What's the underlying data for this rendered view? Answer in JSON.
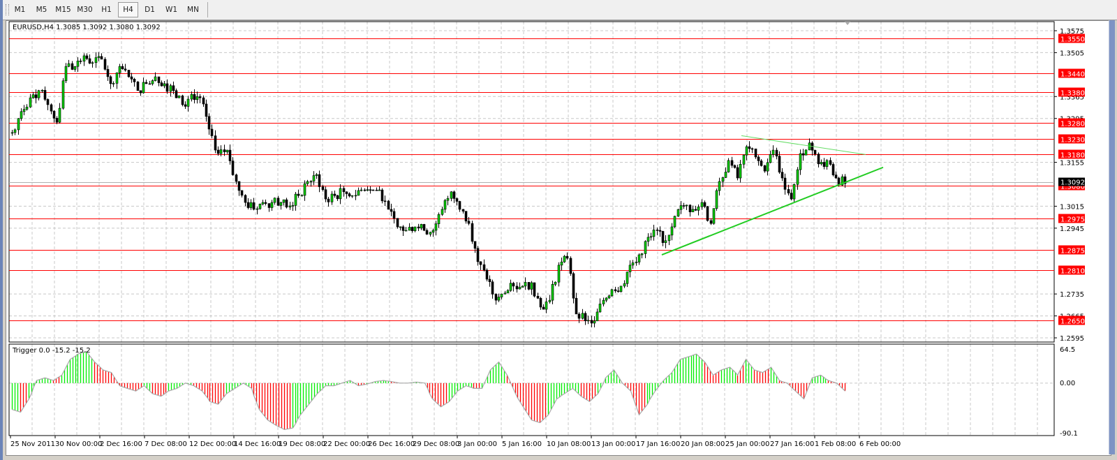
{
  "toolbar": {
    "timeframes": [
      "M1",
      "M5",
      "M15",
      "M30",
      "H1",
      "H4",
      "D1",
      "W1",
      "MN"
    ],
    "active": "H4"
  },
  "chart": {
    "header": "EURUSD,H4  1.3085 1.3092 1.3080 1.3092",
    "current_price": 1.3092,
    "current_price_label": "1.3092"
  },
  "chart_data": {
    "type": "candlestick",
    "symbol": "EURUSD",
    "timeframe": "H4",
    "ylim": [
      1.2595,
      1.3575
    ],
    "price_ticks": [
      "1.3575",
      "1.3505",
      "1.3365",
      "1.3295",
      "1.3155",
      "1.3015",
      "1.2945",
      "1.2735",
      "1.2665",
      "1.2595"
    ],
    "horizontal_levels": [
      "1.3550",
      "1.3440",
      "1.3380",
      "1.3280",
      "1.3230",
      "1.3180",
      "1.3080",
      "1.2975",
      "1.2875",
      "1.2810",
      "1.2650"
    ],
    "level_color": "#ff0000",
    "closes": [
      1.325,
      1.3317,
      1.3361,
      1.3384,
      1.3339,
      1.3283,
      1.3461,
      1.3461,
      1.3495,
      1.3473,
      1.3484,
      1.3406,
      1.3461,
      1.3428,
      1.3384,
      1.3406,
      1.3428,
      1.3406,
      1.3384,
      1.3339,
      1.3372,
      1.3361,
      1.3261,
      1.3183,
      1.3194,
      1.3094,
      1.3027,
      1.3005,
      1.3027,
      1.3027,
      1.3027,
      1.3016,
      1.3049,
      1.3094,
      1.3116,
      1.3038,
      1.3049,
      1.3061,
      1.3049,
      1.3067,
      1.3067,
      1.3067,
      1.3005,
      1.2949,
      1.2938,
      1.2949,
      1.2938,
      1.2938,
      1.3005,
      1.3061,
      1.3005,
      1.296,
      1.2838,
      1.2782,
      1.2715,
      1.2738,
      1.276,
      1.276,
      1.2771,
      1.2693,
      1.2715,
      1.2827,
      1.2849,
      1.2671,
      1.2649,
      1.2649,
      1.2715,
      1.2749,
      1.276,
      1.2827,
      1.286,
      1.2916,
      1.2938,
      1.2905,
      1.2983,
      1.3016,
      1.3005,
      1.3027,
      1.296,
      1.3094,
      1.3161,
      1.3105,
      1.3205,
      1.3172,
      1.3127,
      1.3194,
      1.3105,
      1.3038,
      1.3183,
      1.3217,
      1.315,
      1.3161,
      1.3105,
      1.3087
    ],
    "time_labels": [
      "25 Nov 2011",
      "30 Nov 00:00",
      "2 Dec 16:00",
      "7 Dec 08:00",
      "12 Dec 00:00",
      "14 Dec 16:00",
      "19 Dec 08:00",
      "22 Dec 00:00",
      "26 Dec 16:00",
      "29 Dec 08:00",
      "3 Jan 00:00",
      "5 Jan 16:00",
      "10 Jan 08:00",
      "13 Jan 00:00",
      "17 Jan 16:00",
      "20 Jan 08:00",
      "25 Jan 00:00",
      "27 Jan 16:00",
      "1 Feb 08:00",
      "6 Feb 00:00"
    ],
    "trendlines": [
      {
        "name": "support",
        "from": [
          1.286,
          "20 Jan 08:00"
        ],
        "to": [
          1.312,
          "6 Feb 00:00"
        ],
        "color": "#22cc22"
      },
      {
        "name": "resistance",
        "from": [
          1.324,
          "27 Jan 00:00"
        ],
        "to": [
          1.3185,
          "6 Feb 00:00"
        ],
        "color": "#66dd66"
      }
    ],
    "indicator": {
      "header": "Trigger 0.0 -15.2 -15.2",
      "ylim": [
        -90.1,
        64.5
      ],
      "ticks": [
        "64.5",
        "0.00",
        "-90.1"
      ],
      "up_color": "#00ee00",
      "down_color": "#ff0000",
      "values": [
        -50,
        -55,
        -30,
        5,
        10,
        5,
        15,
        45,
        55,
        60,
        40,
        25,
        20,
        -5,
        -10,
        -15,
        -5,
        -20,
        -25,
        -15,
        -10,
        0,
        -5,
        -15,
        -35,
        -40,
        -20,
        -10,
        0,
        -10,
        -50,
        -70,
        -80,
        -88,
        -85,
        -60,
        -40,
        -20,
        -5,
        -5,
        0,
        5,
        -5,
        -2,
        3,
        5,
        3,
        0,
        0,
        2,
        0,
        -30,
        -45,
        -35,
        -15,
        -5,
        -10,
        -10,
        25,
        40,
        15,
        -20,
        -45,
        -70,
        -75,
        -60,
        -30,
        -20,
        -10,
        -25,
        -35,
        -20,
        10,
        25,
        0,
        -15,
        -60,
        -40,
        -15,
        5,
        20,
        45,
        50,
        55,
        40,
        15,
        25,
        30,
        15,
        45,
        25,
        20,
        30,
        5,
        0,
        -15,
        -30,
        10,
        15,
        5,
        0,
        -15
      ]
    }
  }
}
